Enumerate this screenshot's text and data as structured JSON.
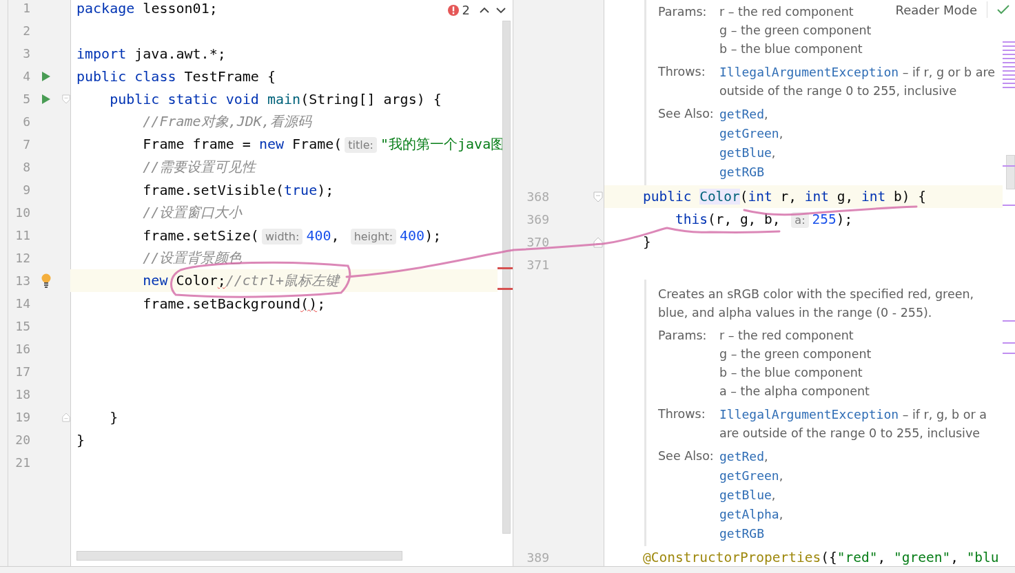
{
  "left_editor": {
    "problems": {
      "count": "2"
    },
    "lines": [
      {
        "number": "1",
        "current": false,
        "run_marker": false,
        "bulb": false,
        "fold_start": false,
        "fold_end": false,
        "tokens": [
          {
            "kind": "keyword",
            "text": "package"
          },
          {
            "kind": "plain",
            "text": " lesson01;"
          }
        ]
      },
      {
        "number": "2",
        "current": false,
        "run_marker": false,
        "bulb": false,
        "fold_start": false,
        "fold_end": false
      },
      {
        "number": "3",
        "current": false,
        "run_marker": false,
        "bulb": false,
        "fold_start": false,
        "fold_end": false,
        "tokens": [
          {
            "kind": "keyword",
            "text": "import"
          },
          {
            "kind": "plain",
            "text": " java.awt.*;"
          }
        ]
      },
      {
        "number": "4",
        "current": false,
        "run_marker": true,
        "bulb": false,
        "fold_start": false,
        "fold_end": false,
        "tokens": [
          {
            "kind": "keyword",
            "text": "public class"
          },
          {
            "kind": "plain",
            "text": " TestFrame {"
          }
        ]
      },
      {
        "number": "5",
        "current": false,
        "run_marker": true,
        "bulb": false,
        "fold_start": true,
        "fold_end": false,
        "tokens": [
          {
            "kind": "keyword",
            "text": "    public static void"
          },
          {
            "kind": "method",
            "text": " main"
          },
          {
            "kind": "plain",
            "text": "(String[] args) {"
          }
        ]
      },
      {
        "number": "6",
        "current": false,
        "run_marker": false,
        "bulb": false,
        "fold_start": false,
        "fold_end": false,
        "tokens": [
          {
            "kind": "comment",
            "text": "        //Frame对象,JDK,看源码"
          }
        ]
      },
      {
        "number": "7",
        "current": false,
        "run_marker": false,
        "bulb": false,
        "fold_start": false,
        "fold_end": false,
        "tokens": [
          {
            "kind": "plain",
            "text": "        Frame frame = "
          },
          {
            "kind": "keyword",
            "text": "new"
          },
          {
            "kind": "plain",
            "text": " Frame("
          },
          {
            "kind": "hint",
            "text": "title:"
          },
          {
            "kind": "string",
            "text": "\"我的第一个java图"
          }
        ]
      },
      {
        "number": "8",
        "current": false,
        "run_marker": false,
        "bulb": false,
        "fold_start": false,
        "fold_end": false,
        "tokens": [
          {
            "kind": "comment",
            "text": "        //需要设置可见性"
          }
        ]
      },
      {
        "number": "9",
        "current": false,
        "run_marker": false,
        "bulb": false,
        "fold_start": false,
        "fold_end": false,
        "tokens": [
          {
            "kind": "plain",
            "text": "        frame.setVisible("
          },
          {
            "kind": "keyword",
            "text": "true"
          },
          {
            "kind": "plain",
            "text": ");"
          }
        ]
      },
      {
        "number": "10",
        "current": false,
        "run_marker": false,
        "bulb": false,
        "fold_start": false,
        "fold_end": false,
        "tokens": [
          {
            "kind": "comment",
            "text": "        //设置窗口大小"
          }
        ]
      },
      {
        "number": "11",
        "current": false,
        "run_marker": false,
        "bulb": false,
        "fold_start": false,
        "fold_end": false,
        "tokens": [
          {
            "kind": "plain",
            "text": "        frame.setSize("
          },
          {
            "kind": "hint",
            "text": "width:"
          },
          {
            "kind": "number",
            "text": "400"
          },
          {
            "kind": "plain",
            "text": ", "
          },
          {
            "kind": "hint",
            "text": "height:"
          },
          {
            "kind": "number",
            "text": "400"
          },
          {
            "kind": "plain",
            "text": ");"
          }
        ]
      },
      {
        "number": "12",
        "current": false,
        "run_marker": false,
        "bulb": false,
        "fold_start": false,
        "fold_end": false,
        "tokens": [
          {
            "kind": "comment",
            "text": "        //设置背景颜色"
          }
        ]
      },
      {
        "number": "13",
        "current": true,
        "run_marker": false,
        "bulb": true,
        "fold_start": false,
        "fold_end": false,
        "tokens": [
          {
            "kind": "keyword",
            "text": "        new"
          },
          {
            "kind": "plain",
            "text": " Color"
          },
          {
            "kind": "error",
            "text": ";"
          },
          {
            "kind": "comment",
            "text": "//ctrl+鼠标左键"
          }
        ]
      },
      {
        "number": "14",
        "current": false,
        "run_marker": false,
        "bulb": false,
        "fold_start": false,
        "fold_end": false,
        "tokens": [
          {
            "kind": "plain",
            "text": "        frame.setBackground"
          },
          {
            "kind": "error",
            "text": "()"
          },
          {
            "kind": "plain",
            "text": ";"
          }
        ]
      },
      {
        "number": "15",
        "current": false,
        "run_marker": false,
        "bulb": false,
        "fold_start": false,
        "fold_end": false
      },
      {
        "number": "16",
        "current": false,
        "run_marker": false,
        "bulb": false,
        "fold_start": false,
        "fold_end": false
      },
      {
        "number": "17",
        "current": false,
        "run_marker": false,
        "bulb": false,
        "fold_start": false,
        "fold_end": false
      },
      {
        "number": "18",
        "current": false,
        "run_marker": false,
        "bulb": false,
        "fold_start": false,
        "fold_end": false
      },
      {
        "number": "19",
        "current": false,
        "run_marker": false,
        "bulb": false,
        "fold_start": false,
        "fold_end": true,
        "tokens": [
          {
            "kind": "plain",
            "text": "    }"
          }
        ]
      },
      {
        "number": "20",
        "current": false,
        "run_marker": false,
        "bulb": false,
        "fold_start": false,
        "fold_end": false,
        "tokens": [
          {
            "kind": "plain",
            "text": "}"
          }
        ]
      },
      {
        "number": "21",
        "current": false,
        "run_marker": false,
        "bulb": false,
        "fold_start": false,
        "fold_end": false
      }
    ]
  },
  "right_editor": {
    "reader_mode": "Reader Mode",
    "items": [
      {
        "kind": "doc",
        "sections": [
          {
            "label": "Params:",
            "entries": [
              {
                "text": "r – the red component"
              },
              {
                "text": "g – the green component"
              },
              {
                "text": "b – the blue component"
              }
            ]
          },
          {
            "label": "Throws:",
            "entries": [
              {
                "link": "IllegalArgumentException",
                "text": " – if r, g or b are outside of the range 0 to 255, inclusive"
              }
            ]
          },
          {
            "label": "See Also:",
            "entries": [
              {
                "link": "getRed",
                "text": ","
              },
              {
                "link": "getGreen",
                "text": ","
              },
              {
                "link": "getBlue",
                "text": ","
              },
              {
                "link": "getRGB"
              }
            ]
          }
        ]
      },
      {
        "kind": "code",
        "number": "368",
        "current": true,
        "fold_start": true,
        "fold_end": false,
        "tokens": [
          {
            "kind": "keyword",
            "text": "public"
          },
          {
            "kind": "highlight",
            "text": "Color"
          },
          {
            "kind": "plain",
            "text": "("
          },
          {
            "kind": "keyword",
            "text": "int"
          },
          {
            "kind": "plain",
            "text": " r, "
          },
          {
            "kind": "keyword",
            "text": "int"
          },
          {
            "kind": "plain",
            "text": " g, "
          },
          {
            "kind": "keyword",
            "text": "int"
          },
          {
            "kind": "plain",
            "text": " b) {"
          }
        ]
      },
      {
        "kind": "code",
        "number": "369",
        "current": false,
        "fold_start": false,
        "fold_end": false,
        "tokens": [
          {
            "kind": "keyword",
            "text": "    this"
          },
          {
            "kind": "plain",
            "text": "(r, g, b, "
          },
          {
            "kind": "hint",
            "text": "a:"
          },
          {
            "kind": "number",
            "text": "255"
          },
          {
            "kind": "plain",
            "text": ");"
          }
        ]
      },
      {
        "kind": "code",
        "number": "370",
        "current": false,
        "fold_start": false,
        "fold_end": true,
        "tokens": [
          {
            "kind": "plain",
            "text": "}"
          }
        ]
      },
      {
        "kind": "code",
        "number": "371",
        "current": false,
        "fold_start": false,
        "fold_end": false
      },
      {
        "kind": "doc",
        "description": "Creates an sRGB color with the specified red, green, blue, and alpha values in the range (0 - 255).",
        "sections": [
          {
            "label": "Params:",
            "entries": [
              {
                "text": "r – the red component"
              },
              {
                "text": "g – the green component"
              },
              {
                "text": "b – the blue component"
              },
              {
                "text": "a – the alpha component"
              }
            ]
          },
          {
            "label": "Throws:",
            "entries": [
              {
                "link": "IllegalArgumentException",
                "text": " – if r, g, b or a are outside of the range 0 to 255, inclusive"
              }
            ]
          },
          {
            "label": "See Also:",
            "entries": [
              {
                "link": "getRed",
                "text": ","
              },
              {
                "link": "getGreen",
                "text": ","
              },
              {
                "link": "getBlue",
                "text": ","
              },
              {
                "link": "getAlpha",
                "text": ","
              },
              {
                "link": "getRGB"
              }
            ]
          }
        ]
      },
      {
        "kind": "code",
        "number": "389",
        "current": false,
        "fold_start": false,
        "fold_end": false,
        "tokens": [
          {
            "kind": "annotation",
            "text": "@ConstructorProperties"
          },
          {
            "kind": "plain",
            "text": "({"
          },
          {
            "kind": "string",
            "text": "\"red\""
          },
          {
            "kind": "plain",
            "text": ", "
          },
          {
            "kind": "string",
            "text": "\"green\""
          },
          {
            "kind": "plain",
            "text": ", "
          },
          {
            "kind": "string",
            "text": "\"blu"
          }
        ]
      }
    ]
  }
}
